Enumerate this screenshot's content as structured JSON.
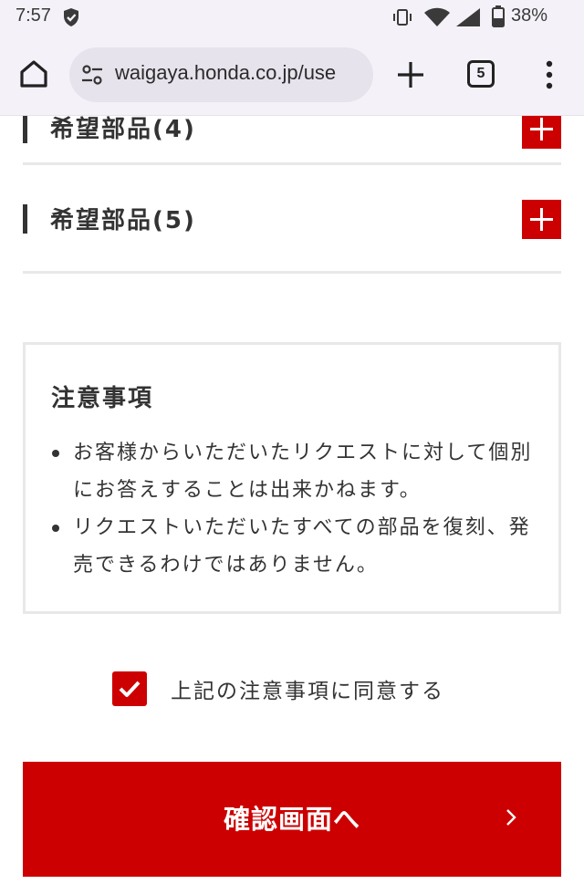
{
  "status_bar": {
    "time": "7:57",
    "battery": "38%"
  },
  "browser": {
    "url": "waigaya.honda.co.jp/use",
    "tab_count": "5"
  },
  "parts": [
    {
      "label": "希望部品(4)"
    },
    {
      "label": "希望部品(5)"
    }
  ],
  "notice": {
    "title": "注意事項",
    "items": [
      "お客様からいただいたリクエストに対して個別にお答えすることは出来かねます。",
      "リクエストいただいたすべての部品を復刻、発売できるわけではありません。"
    ]
  },
  "agree": {
    "label": "上記の注意事項に同意する",
    "checked": true
  },
  "confirm": {
    "label": "確認画面へ"
  },
  "colors": {
    "accent": "#cc0000",
    "text": "#333333",
    "divider": "#e8e8e8",
    "chrome_bg": "#f4f2f8"
  },
  "icons": [
    "shield-check-icon",
    "vibrate-icon",
    "wifi-icon",
    "signal-icon",
    "battery-icon",
    "home-icon",
    "site-settings-icon",
    "plus-icon",
    "tab-switcher-icon",
    "more-vert-icon",
    "expand-plus-icon",
    "checkmark-icon",
    "chevron-right-icon"
  ]
}
